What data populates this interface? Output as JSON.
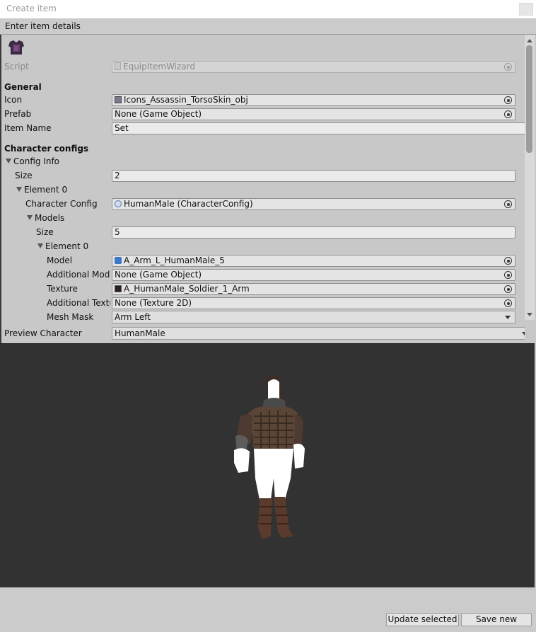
{
  "window": {
    "title": "Create item"
  },
  "header": {
    "text": "Enter item details"
  },
  "icon_name": "armor-torso-icon",
  "fields": {
    "script": {
      "label": "Script",
      "value": "EquipItemWizard"
    },
    "general_heading": "General",
    "icon": {
      "label": "Icon",
      "value": "Icons_Assassin_TorsoSkin_obj"
    },
    "prefab": {
      "label": "Prefab",
      "value": "None (Game Object)"
    },
    "item_name": {
      "label": "Item Name",
      "value": "Set"
    },
    "character_configs_heading": "Character configs",
    "config_info": {
      "label": "Config Info"
    },
    "size": {
      "label": "Size",
      "value": "2"
    },
    "element0": {
      "label": "Element 0"
    },
    "character_config": {
      "label": "Character Config",
      "value": "HumanMale (CharacterConfig)"
    },
    "models": {
      "label": "Models"
    },
    "models_size": {
      "label": "Size",
      "value": "5"
    },
    "models_element0": {
      "label": "Element 0"
    },
    "model": {
      "label": "Model",
      "value": "A_Arm_L_HumanMale_5"
    },
    "additional_model": {
      "label": "Additional Model",
      "value": "None (Game Object)"
    },
    "texture": {
      "label": "Texture",
      "value": "A_HumanMale_Soldier_1_Arm"
    },
    "additional_texture": {
      "label": "Additional Texture",
      "value": "None (Texture 2D)"
    },
    "mesh_mask": {
      "label": "Mesh Mask",
      "value": "Arm Left"
    }
  },
  "preview": {
    "label": "Preview Character",
    "value": "HumanMale"
  },
  "buttons": {
    "update_selected": "Update selected",
    "save_new": "Save new"
  },
  "colors": {
    "viewport_bg": "#323232",
    "panel_bg": "#c8c8c8"
  }
}
